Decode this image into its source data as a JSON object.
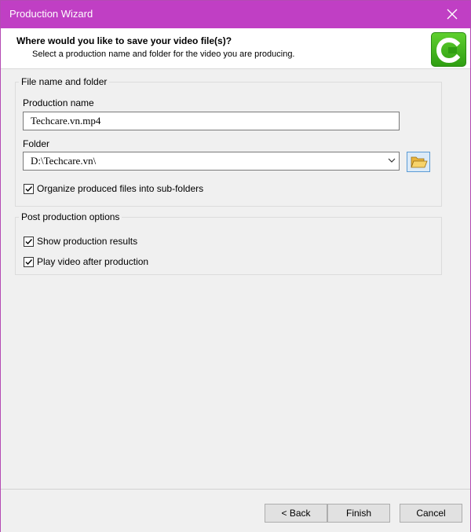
{
  "window": {
    "title": "Production Wizard"
  },
  "header": {
    "title": "Where would you like to save your video file(s)?",
    "subtitle": "Select a production name and folder for the video you are producing."
  },
  "file_group": {
    "legend": "File name and folder",
    "production_name_label": "Production name",
    "production_name_value": "Techcare.vn.mp4",
    "folder_label": "Folder",
    "folder_value": "D:\\Techcare.vn\\",
    "organize_checkbox": {
      "label": "Organize produced files into sub-folders",
      "checked": true
    }
  },
  "post_group": {
    "legend": "Post production options",
    "show_results": {
      "label": "Show production results",
      "checked": true
    },
    "play_video": {
      "label": "Play video after production",
      "checked": true
    }
  },
  "footer": {
    "back_label": "< Back",
    "finish_label": "Finish",
    "cancel_label": "Cancel"
  },
  "icons": {
    "close": "close-icon",
    "logo": "camtasia-logo-icon",
    "browse": "folder-open-icon",
    "dropdown": "chevron-down-icon"
  },
  "colors": {
    "titlebar": "#c03fc4",
    "logo": "#4cb81f"
  }
}
